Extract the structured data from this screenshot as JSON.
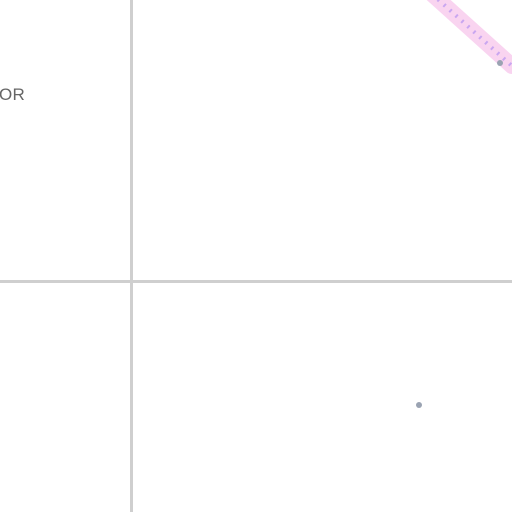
{
  "label": {
    "text": "OR"
  },
  "colors": {
    "background": "#ffffff",
    "divider": "#cfcfcf",
    "label": "#666666",
    "connector_glow": "#f7c6ec",
    "connector_dash": "#c9a6f0",
    "dot": "#9aa3b2"
  }
}
